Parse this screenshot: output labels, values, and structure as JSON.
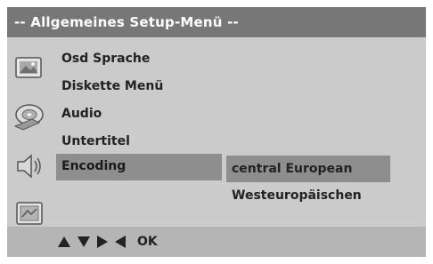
{
  "title": "-- Allgemeines Setup-Menü --",
  "menu": {
    "items": [
      {
        "label": "Osd Sprache"
      },
      {
        "label": "Diskette Menü"
      },
      {
        "label": "Audio"
      },
      {
        "label": "Untertitel"
      },
      {
        "label": "Encoding",
        "selected": true
      }
    ]
  },
  "submenu": {
    "options": [
      {
        "label": "central European",
        "highlighted": true
      },
      {
        "label": "Westeuropäischen"
      }
    ]
  },
  "icons": [
    "picture-settings-icon",
    "disc-speaker-icon",
    "speaker-icon",
    "preferences-icon"
  ],
  "footer": {
    "nav_hint": "OK",
    "arrows": [
      "up-arrow-icon",
      "down-arrow-icon",
      "right-arrow-icon",
      "left-arrow-icon"
    ]
  },
  "colors": {
    "titlebar": "#777777",
    "background": "#cbcbcb",
    "selection": "#8e8e8e",
    "footer": "#b5b5b5"
  }
}
